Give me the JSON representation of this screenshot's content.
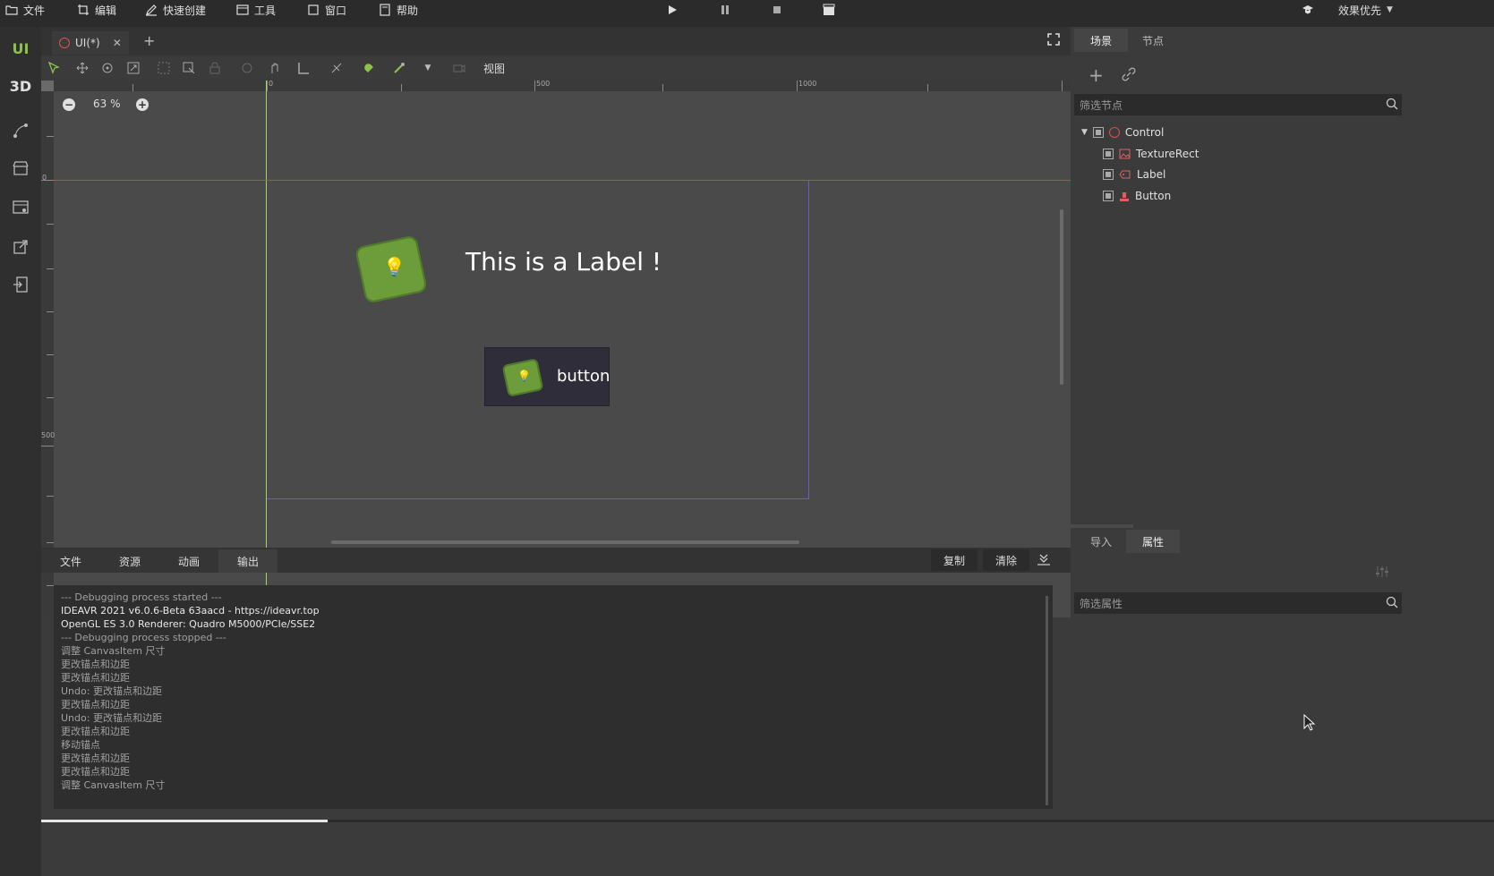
{
  "menu": {
    "file": "文件",
    "edit": "编辑",
    "quick_create": "快速创建",
    "tools": "工具",
    "window": "窗口",
    "help": "帮助",
    "quality": "效果优先"
  },
  "sidebar": {
    "ui": "UI",
    "three_d": "3D"
  },
  "document_tab": {
    "title": "UI(*)"
  },
  "toolbar": {
    "view": "视图"
  },
  "viewport": {
    "zoom": "63 %",
    "ruler_top": [
      "0",
      "500",
      "1000"
    ],
    "ruler_left": [
      "0",
      "500"
    ],
    "label_text": "This is a Label !",
    "button_text": "button"
  },
  "bottom_panel": {
    "tabs": [
      "文件",
      "资源",
      "动画",
      "输出"
    ],
    "copy_label": "复制",
    "clear_label": "清除",
    "log": [
      "--- Debugging process started ---",
      "IDEAVR 2021 v6.0.6-Beta 63aacd - https://ideavr.top",
      "OpenGL ES 3.0 Renderer: Quadro M5000/PCIe/SSE2",
      "",
      "--- Debugging process stopped ---",
      "调整 CanvasItem 尺寸",
      "更改锚点和边距",
      "更改锚点和边距",
      "Undo: 更改锚点和边距",
      "更改锚点和边距",
      "Undo: 更改锚点和边距",
      "更改锚点和边距",
      "移动锚点",
      "更改锚点和边距",
      "更改锚点和边距",
      "调整 CanvasItem 尺寸"
    ]
  },
  "scene_panel": {
    "tab_scene": "场景",
    "tab_node": "节点",
    "filter_placeholder": "筛选节点",
    "nodes": [
      "Control",
      "TextureRect",
      "Label",
      "Button"
    ]
  },
  "props_panel": {
    "tab_import": "导入",
    "tab_props": "属性",
    "filter_placeholder": "筛选属性"
  }
}
